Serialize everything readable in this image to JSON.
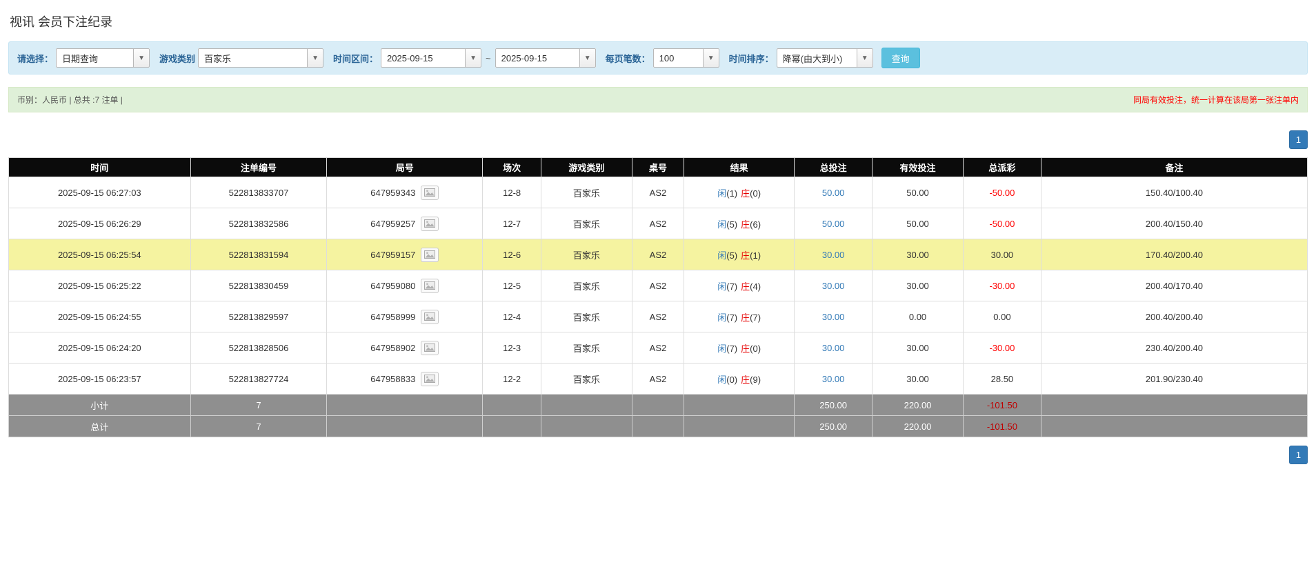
{
  "page": {
    "title": "视讯 会员下注纪录"
  },
  "colors": {
    "accent_blue": "#337ab7",
    "link_blue": "#337ab7",
    "danger_red": "#ff0000",
    "search_button_cyan": "#5bc0de",
    "filter_bar_bg": "#d9edf7",
    "summary_bar_bg": "#dff0d8",
    "table_header_bg": "#0b0b0b",
    "footer_row_bg": "#8f8f8f",
    "highlight_row_yellow": "#f5f3a0"
  },
  "filters": {
    "select_label": "请选择：",
    "select_value": "日期查询",
    "game_type_label": "游戏类别",
    "game_type_value": "百家乐",
    "date_range_label": "时间区间：",
    "date_from": "2025-09-15",
    "tilde": "~",
    "date_to": "2025-09-15",
    "page_size_label": "每页笔数：",
    "page_size_value": "100",
    "sort_label": "时间排序：",
    "sort_value": "降幂(由大到小)",
    "search_button_label": "查询",
    "caret_glyph": "▼"
  },
  "summary": {
    "left_text": "币别：人民币 | 总共 :7 注单 |",
    "right_text": "同局有效投注，统一计算在该局第一张注单内"
  },
  "pagination": {
    "current_page": "1"
  },
  "table": {
    "headers": [
      "时间",
      "注单编号",
      "局号",
      "场次",
      "游戏类别",
      "桌号",
      "结果",
      "总投注",
      "有效投注",
      "总派彩",
      "备注"
    ],
    "result_labels": {
      "player": "闲",
      "banker": "庄"
    },
    "round_icon": "game-result-image-icon",
    "rows": [
      {
        "time": "2025-09-15 06:27:03",
        "bet_id": "522813833707",
        "round_id": "647959343",
        "session": "12-8",
        "game": "百家乐",
        "table_no": "AS2",
        "player_num": "(1)",
        "banker_num": "(0)",
        "total_bet": "50.00",
        "valid_bet": "50.00",
        "payout": "-50.00",
        "note": "150.40/100.40",
        "highlight": false
      },
      {
        "time": "2025-09-15 06:26:29",
        "bet_id": "522813832586",
        "round_id": "647959257",
        "session": "12-7",
        "game": "百家乐",
        "table_no": "AS2",
        "player_num": "(5)",
        "banker_num": "(6)",
        "total_bet": "50.00",
        "valid_bet": "50.00",
        "payout": "-50.00",
        "note": "200.40/150.40",
        "highlight": false
      },
      {
        "time": "2025-09-15 06:25:54",
        "bet_id": "522813831594",
        "round_id": "647959157",
        "session": "12-6",
        "game": "百家乐",
        "table_no": "AS2",
        "player_num": "(5)",
        "banker_num": "(1)",
        "total_bet": "30.00",
        "valid_bet": "30.00",
        "payout": "30.00",
        "note": "170.40/200.40",
        "highlight": true
      },
      {
        "time": "2025-09-15 06:25:22",
        "bet_id": "522813830459",
        "round_id": "647959080",
        "session": "12-5",
        "game": "百家乐",
        "table_no": "AS2",
        "player_num": "(7)",
        "banker_num": "(4)",
        "total_bet": "30.00",
        "valid_bet": "30.00",
        "payout": "-30.00",
        "note": "200.40/170.40",
        "highlight": false
      },
      {
        "time": "2025-09-15 06:24:55",
        "bet_id": "522813829597",
        "round_id": "647958999",
        "session": "12-4",
        "game": "百家乐",
        "table_no": "AS2",
        "player_num": "(7)",
        "banker_num": "(7)",
        "total_bet": "30.00",
        "valid_bet": "0.00",
        "payout": "0.00",
        "note": "200.40/200.40",
        "highlight": false
      },
      {
        "time": "2025-09-15 06:24:20",
        "bet_id": "522813828506",
        "round_id": "647958902",
        "session": "12-3",
        "game": "百家乐",
        "table_no": "AS2",
        "player_num": "(7)",
        "banker_num": "(0)",
        "total_bet": "30.00",
        "valid_bet": "30.00",
        "payout": "-30.00",
        "note": "230.40/200.40",
        "highlight": false
      },
      {
        "time": "2025-09-15 06:23:57",
        "bet_id": "522813827724",
        "round_id": "647958833",
        "session": "12-2",
        "game": "百家乐",
        "table_no": "AS2",
        "player_num": "(0)",
        "banker_num": "(9)",
        "total_bet": "30.00",
        "valid_bet": "30.00",
        "payout": "28.50",
        "note": "201.90/230.40",
        "highlight": false
      }
    ],
    "subtotal": {
      "label": "小计",
      "count": "7",
      "total_bet": "250.00",
      "valid_bet": "220.00",
      "payout": "-101.50"
    },
    "grand_total": {
      "label": "总计",
      "count": "7",
      "total_bet": "250.00",
      "valid_bet": "220.00",
      "payout": "-101.50"
    }
  }
}
